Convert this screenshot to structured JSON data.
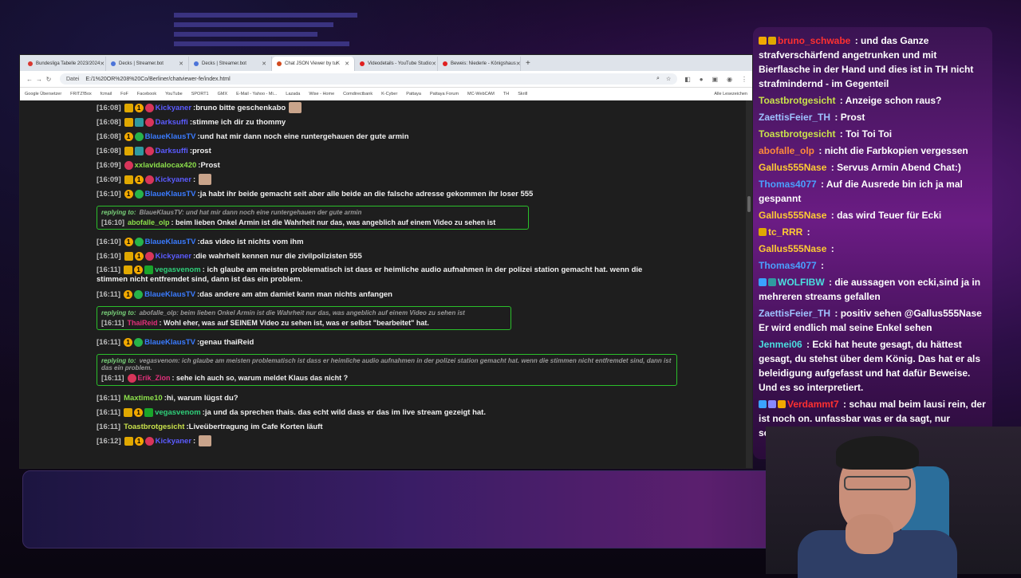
{
  "browser": {
    "tabs": [
      {
        "label": "Bundesliga Tabelle 2023/2024",
        "color": "#d9372f",
        "active": false
      },
      {
        "label": "Decks | Streamer.bot",
        "color": "#4c74d9",
        "active": false
      },
      {
        "label": "Decks | Streamer.bot",
        "color": "#4c74d9",
        "active": false
      },
      {
        "label": "Chat JSON Viewer by tuK",
        "color": "#d24a1e",
        "active": true
      },
      {
        "label": "Videodetails - YouTube Studio",
        "color": "#e02020",
        "active": false
      },
      {
        "label": "Beweis: Niederle - Königshaus",
        "color": "#e02020",
        "active": false
      }
    ],
    "new_tab": "+",
    "address_prefix": "Datei",
    "url": "E:/1%20OR%208%20Co/Berliner/chatviewer-fe/index.html",
    "bookmarks": [
      "Google Übersetzer",
      "FRITZ!Box",
      "fcmail",
      "FoF",
      "Facebook",
      "YouTube",
      "SPORT1",
      "GMX",
      "E-Mail - Yahoo - Mi...",
      "Lazada",
      "Wise - Home",
      "Comdirectbank",
      "K-Cyber",
      "Pattaya",
      "Pattaya Forum",
      "MC-WebCAM",
      "TH",
      "Skrill"
    ],
    "bookmarks_right": "Alle Lesezeichen"
  },
  "chat": [
    {
      "t": "[16:08]",
      "badges": [
        "crown",
        "one",
        "glob"
      ],
      "nick": "Kickyaner",
      "color": "#5b5bff",
      "text": "bruno bitte geschenkabo",
      "emote": true
    },
    {
      "t": "[16:08]",
      "badges": [
        "crown",
        "vip",
        "glob"
      ],
      "nick": "Darksuffi",
      "color": "#5b5bff",
      "text": "stimme ich dir zu thommy"
    },
    {
      "t": "[16:08]",
      "badges": [
        "one",
        "check"
      ],
      "nick": "BlaueKlausTV",
      "color": "#3a7bff",
      "text": "und hat mir dann noch eine runtergehauen der gute armin"
    },
    {
      "t": "[16:08]",
      "badges": [
        "crown",
        "vip",
        "glob"
      ],
      "nick": "Darksuffi",
      "color": "#5b5bff",
      "text": "prost"
    },
    {
      "t": "[16:09]",
      "badges": [
        "glob"
      ],
      "nick": "xxlavidalocax420",
      "color": "#8ce04b",
      "text": "Prost"
    },
    {
      "t": "[16:09]",
      "badges": [
        "crown",
        "one",
        "glob"
      ],
      "nick": "Kickyaner",
      "color": "#5b5bff",
      "text": "",
      "emote": true
    },
    {
      "t": "[16:10]",
      "badges": [
        "one",
        "check"
      ],
      "nick": "BlaueKlausTV",
      "color": "#3a7bff",
      "text": "ja habt ihr beide gemacht seit aber alle beide an die falsche adresse gekommen ihr loser 555"
    },
    {
      "reply": true,
      "label": "replying to:",
      "head": "BlaueKlausTV: und hat mir dann noch eine runtergehauen der gute armin",
      "t": "[16:10]",
      "nick": "abofalle_olp",
      "color": "#8ce04b",
      "text": "beim lieben Onkel Armin ist die Wahrheit nur das, was angeblich auf einem Video zu sehen ist",
      "width": 530
    },
    {
      "t": "[16:10]",
      "badges": [
        "one",
        "check"
      ],
      "nick": "BlaueKlausTV",
      "color": "#3a7bff",
      "text": "das video ist nichts vom ihm"
    },
    {
      "t": "[16:10]",
      "badges": [
        "crown",
        "one",
        "glob"
      ],
      "nick": "Kickyaner",
      "color": "#5b5bff",
      "text": "die wahrheit kennen nur die zivilpolizisten 555"
    },
    {
      "t": "[16:11]",
      "badges": [
        "crown",
        "one",
        "green"
      ],
      "nick": "vegasvenom",
      "color": "#2fd07a",
      "text": "ich glaube am meisten problematisch ist dass er heimliche audio aufnahmen in der polizei station gemacht hat. wenn die stimmen nicht entfremdet sind, dann ist das ein problem.",
      "multi": true
    },
    {
      "t": "[16:11]",
      "badges": [
        "one",
        "check"
      ],
      "nick": "BlaueKlausTV",
      "color": "#3a7bff",
      "text": "das andere am atm damiet kann man nichts anfangen"
    },
    {
      "reply": true,
      "label": "replying to:",
      "head": "abofalle_olp: beim lieben Onkel Armin ist die Wahrheit nur das, was angeblich auf einem Video zu sehen ist",
      "t": "[16:11]",
      "nick": "ThaiReid",
      "color": "#e0307a",
      "text": "Wohl eher, was auf SEINEM Video zu sehen ist, was er selbst \"bearbeitet\" hat.",
      "width": 508
    },
    {
      "t": "[16:11]",
      "badges": [
        "one",
        "check"
      ],
      "nick": "BlaueKlausTV",
      "color": "#3a7bff",
      "text": "genau thaiReid"
    },
    {
      "reply": true,
      "label": "replying to:",
      "head": "vegasvenom: ich glaube am meisten problematisch ist dass er heimliche audio aufnahmen in der polizei station gemacht hat. wenn die stimmen nicht entfremdet sind, dann ist das ein problem.",
      "t": "[16:11]",
      "badges": [
        "glob"
      ],
      "nick": "Erik_Zion",
      "color": "#e0307a",
      "text": "sehe ich auch so, warum meldet Klaus das nicht ?",
      "width": 716
    },
    {
      "t": "[16:11]",
      "badges": [],
      "nick": "Maxtime10",
      "color": "#8ce04b",
      "text": "hi, warum lügst du?"
    },
    {
      "t": "[16:11]",
      "badges": [
        "crown",
        "one",
        "green"
      ],
      "nick": "vegasvenom",
      "color": "#2fd07a",
      "text": "ja und da sprechen thais. das echt wild dass er das im live stream gezeigt hat."
    },
    {
      "t": "[16:11]",
      "badges": [],
      "nick": "Toastbrotgesicht",
      "color": "#c8e04b",
      "text": "Liveübertragung im Cafe Korten läuft"
    },
    {
      "t": "[16:12]",
      "badges": [
        "crown",
        "one",
        "glob"
      ],
      "nick": "Kickyaner",
      "color": "#5b5bff",
      "text": "",
      "emote": true
    }
  ],
  "overlay": [
    {
      "nick": "bruno_schwabe",
      "color": "#ff3030",
      "badges": [
        "#f2a900",
        "#e0a800"
      ],
      "text": "und das Ganze strafverschärfend angetrunken und mit Bierflasche in der Hand und dies ist in TH nicht strafmindernd - im Gegenteil"
    },
    {
      "nick": "Toastbrotgesicht",
      "color": "#c8e04b",
      "badges": [],
      "text": "Anzeige schon raus?"
    },
    {
      "nick": "ZaettisFeier_TH",
      "color": "#9ec2ff",
      "badges": [],
      "text": "Prost"
    },
    {
      "nick": "Toastbrotgesicht",
      "color": "#c8e04b",
      "badges": [],
      "text": "Toi Toi Toi"
    },
    {
      "nick": "abofalle_olp",
      "color": "#ff8a3a",
      "badges": [],
      "text": "nicht die Farbkopien vergessen"
    },
    {
      "nick": "Gallus555Nase",
      "color": "#ffcc33",
      "badges": [],
      "text": "Servus Armin Abend Chat:)"
    },
    {
      "nick": "Thomas4077",
      "color": "#4aa0ff",
      "badges": [],
      "text": "Auf die Ausrede bin ich ja mal gespannt"
    },
    {
      "nick": "Gallus555Nase",
      "color": "#ffcc33",
      "badges": [],
      "text": "das wird Teuer für Ecki"
    },
    {
      "nick": "tc_RRR",
      "color": "#ffcc33",
      "badges": [
        "#e0a800"
      ],
      "text": ""
    },
    {
      "nick": "Gallus555Nase",
      "color": "#ffcc33",
      "badges": [],
      "text": ""
    },
    {
      "nick": "Thomas4077",
      "color": "#4aa0ff",
      "badges": [],
      "text": ""
    },
    {
      "nick": "WOLFIBW",
      "color": "#4adfe0",
      "badges": [
        "#3aa3ff",
        "#2f9aa0"
      ],
      "text": "die aussagen von ecki,sind ja in mehreren streams gefallen"
    },
    {
      "nick": "ZaettisFeier_TH",
      "color": "#9ec2ff",
      "badges": [],
      "text": "positiv sehen @Gallus555Nase Er wird endlich mal seine Enkel sehen"
    },
    {
      "nick": "Jenmei06",
      "color": "#4adfe0",
      "badges": [],
      "text": "Ecki hat heute gesagt, du hättest gesagt, du stehst über dem König. Das hat er als beleidigung aufgefasst und hat dafür Beweise. Und es so interpretiert."
    },
    {
      "nick": "Verdammt7",
      "color": "#ff3030",
      "badges": [
        "#3aa3ff",
        "#8888ff",
        "#f2a900"
      ],
      "text": "schau mal beim lausi rein, der ist noch on. unfassbar was er da sagt, nur schmutz."
    }
  ]
}
